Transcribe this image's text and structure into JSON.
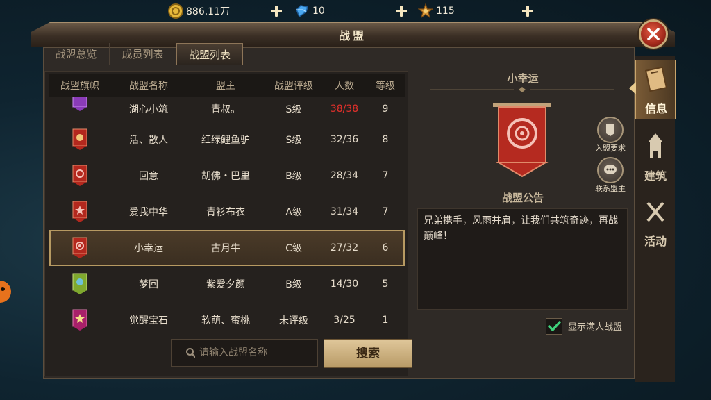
{
  "resources": {
    "gold": {
      "value": "886.11万",
      "icon": "gold-coin-icon"
    },
    "gem": {
      "value": "10",
      "icon": "blue-gem-icon"
    },
    "star": {
      "value": "115",
      "icon": "star-medal-icon"
    }
  },
  "window": {
    "title": "战盟"
  },
  "tabs": [
    {
      "label": "战盟总览"
    },
    {
      "label": "成员列表"
    },
    {
      "label": "战盟列表"
    }
  ],
  "table": {
    "headers": [
      "战盟旗帜",
      "战盟名称",
      "盟主",
      "战盟评级",
      "人数",
      "等级"
    ],
    "rows": [
      {
        "name": "湖心小筑",
        "owner": "青叔。",
        "rank": "S级",
        "count": "38/38",
        "level": "9",
        "banner": "purple"
      },
      {
        "name": "活、散人",
        "owner": "红绿鲤鱼驴",
        "rank": "S级",
        "count": "32/36",
        "level": "8",
        "banner": "red"
      },
      {
        "name": "回意",
        "owner": "胡佛・巴里",
        "rank": "B级",
        "count": "28/34",
        "level": "7",
        "banner": "red"
      },
      {
        "name": "爱我中华",
        "owner": "青衫布衣",
        "rank": "A级",
        "count": "31/34",
        "level": "7",
        "banner": "red"
      },
      {
        "name": "小幸运",
        "owner": "古月牛",
        "rank": "C级",
        "count": "27/32",
        "level": "6",
        "banner": "red"
      },
      {
        "name": "梦回",
        "owner": "紫爱夕颜",
        "rank": "B级",
        "count": "14/30",
        "level": "5",
        "banner": "green"
      },
      {
        "name": "觉醒宝石",
        "owner": "软萌、蜜桃",
        "rank": "未评级",
        "count": "3/25",
        "level": "1",
        "banner": "magenta"
      }
    ]
  },
  "search": {
    "placeholder": "请输入战盟名称",
    "button": "搜索"
  },
  "detail": {
    "name": "小幸运",
    "join_req": "入盟要求",
    "contact": "联系盟主",
    "notice_title": "战盟公告",
    "notice_text": "兄弟携手，风雨并肩，让我们共筑奇迹，再战巅峰！",
    "show_full_label": "显示满人战盟",
    "show_full_checked": true
  },
  "side_tabs": [
    {
      "label": "信息",
      "icon": "book-icon"
    },
    {
      "label": "建筑",
      "icon": "tower-icon"
    },
    {
      "label": "活动",
      "icon": "crossed-swords-icon"
    }
  ],
  "colors": {
    "full_count": "#e0302b",
    "accent": "#b79a62"
  }
}
